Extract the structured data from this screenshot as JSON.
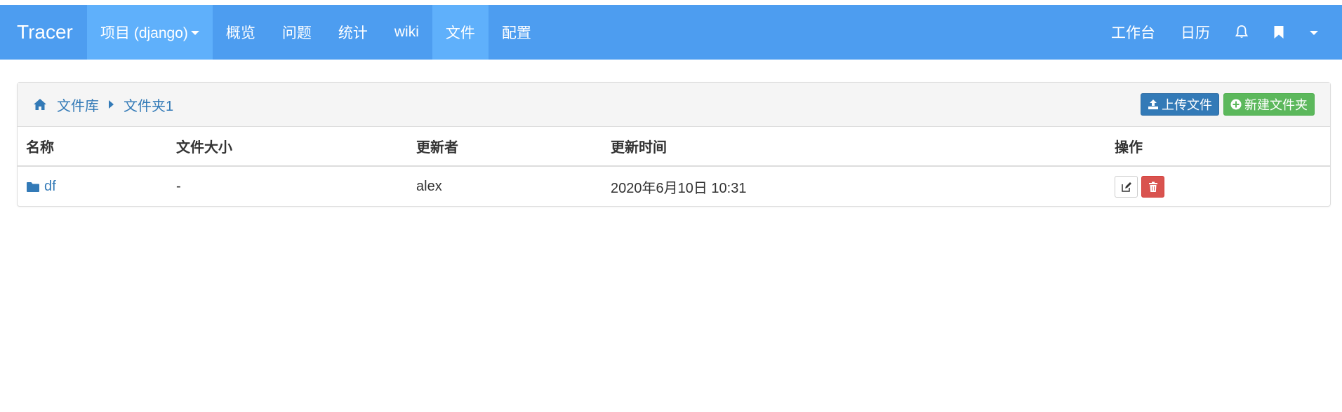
{
  "navbar": {
    "brand": "Tracer",
    "left_items": [
      {
        "label": "项目 (django)",
        "active": true,
        "dropdown": true
      },
      {
        "label": "概览",
        "active": false
      },
      {
        "label": "问题",
        "active": false
      },
      {
        "label": "统计",
        "active": false
      },
      {
        "label": "wiki",
        "active": false
      },
      {
        "label": "文件",
        "active": true
      },
      {
        "label": "配置",
        "active": false
      }
    ],
    "right_items": [
      {
        "label": "工作台"
      },
      {
        "label": "日历"
      }
    ],
    "icons": [
      "bell-icon",
      "bookmark-icon",
      "caret-down-icon"
    ]
  },
  "breadcrumb": {
    "home_icon": "home-icon",
    "items": [
      "文件库",
      "文件夹1"
    ]
  },
  "toolbar": {
    "upload_label": "上传文件",
    "new_folder_label": "新建文件夹"
  },
  "table": {
    "headers": [
      "名称",
      "文件大小",
      "更新者",
      "更新时间",
      "操作"
    ],
    "rows": [
      {
        "name": "df",
        "type": "folder",
        "size": "-",
        "updater": "alex",
        "updated_at": "2020年6月10日 10:31"
      }
    ]
  },
  "colors": {
    "navbar": "#4d9df0",
    "navbar_active": "#5fb0fb",
    "link": "#337ab7",
    "primary": "#337ab7",
    "success": "#5cb85c",
    "danger": "#d9534f"
  }
}
